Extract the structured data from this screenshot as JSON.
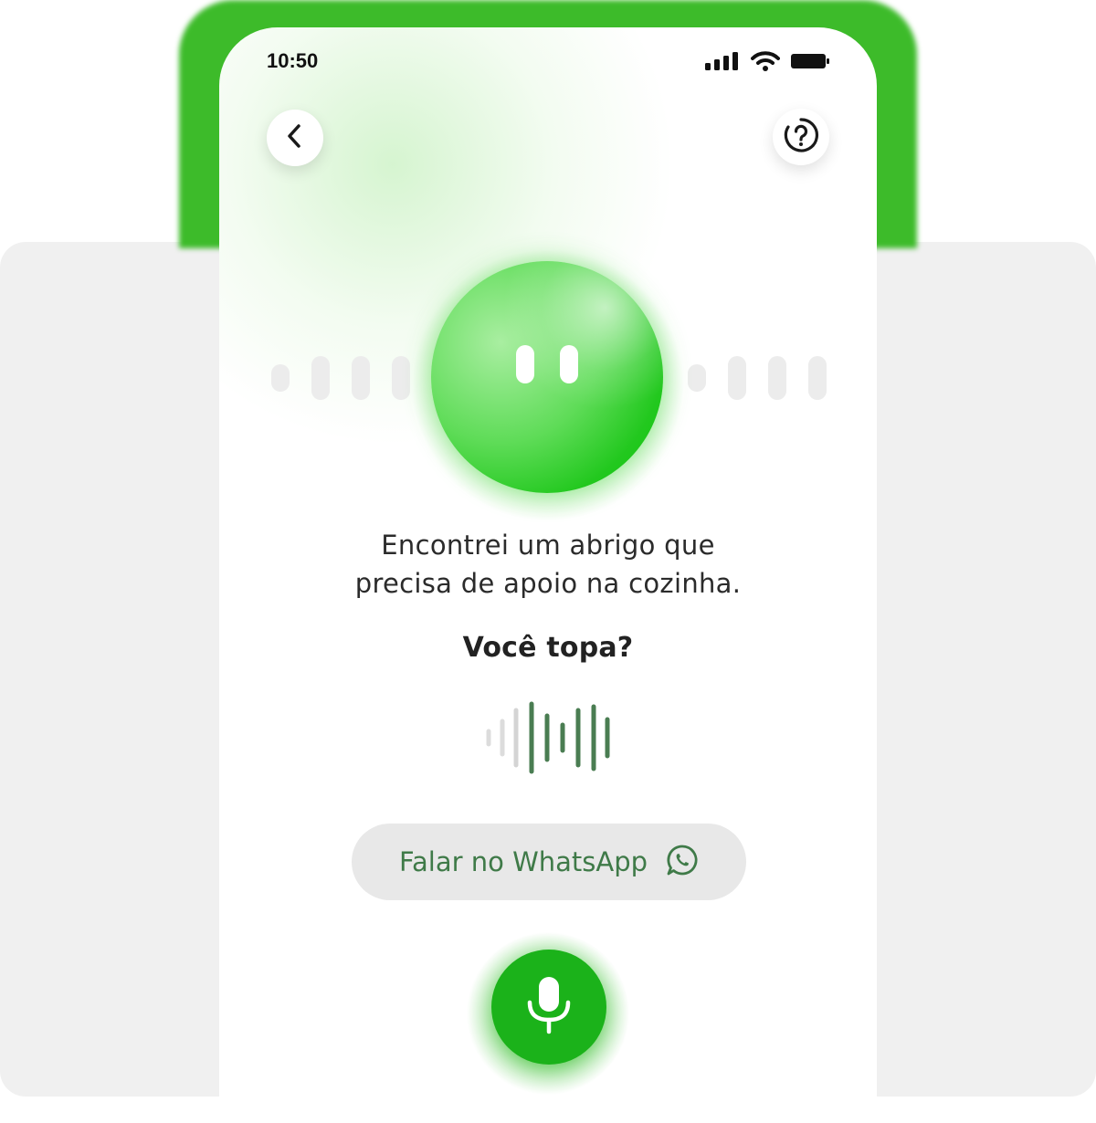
{
  "status_bar": {
    "time": "10:50",
    "signal_icon": "cellular-signal-icon",
    "wifi_icon": "wifi-icon",
    "battery_icon": "battery-icon"
  },
  "header": {
    "back_icon": "chevron-left-icon",
    "help_icon": "question-circle-icon"
  },
  "assistant": {
    "avatar": "green-orb-face",
    "message_lines": [
      "Encontrei um abrigo que",
      "precisa de apoio na cozinha."
    ],
    "question": "Você topa?"
  },
  "whatsapp_button": {
    "label": "Falar no WhatsApp",
    "icon": "whatsapp-icon"
  },
  "mic_button": {
    "icon": "microphone-icon"
  },
  "colors": {
    "accent_green": "#1bb21a",
    "frame_green": "#3dbb2a",
    "waveform_active": "#4a7d52",
    "waveform_inactive": "#d9d9d9",
    "button_text": "#3f7a48"
  }
}
